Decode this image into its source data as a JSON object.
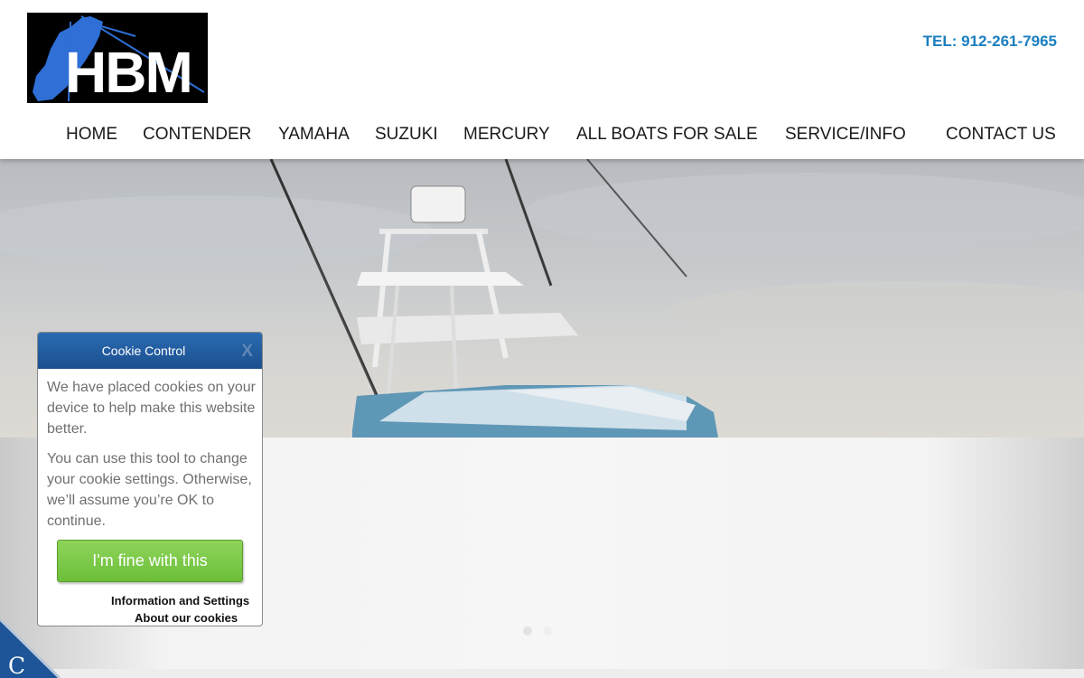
{
  "brand": {
    "logo_text": "HBM",
    "colors": {
      "logo_bg": "#000000",
      "logo_blue": "#2f6fd6",
      "logo_white": "#ffffff"
    }
  },
  "header": {
    "tel": "TEL: 912-261-7965"
  },
  "nav": {
    "items": [
      {
        "label": "HOME"
      },
      {
        "label": "CONTENDER"
      },
      {
        "label": "YAMAHA"
      },
      {
        "label": "SUZUKI"
      },
      {
        "label": "MERCURY"
      },
      {
        "label": "ALL BOATS FOR SALE"
      },
      {
        "label": "SERVICE/INFO"
      },
      {
        "label": "CONTACT US"
      }
    ]
  },
  "hero": {
    "image_subject": "boat-photo"
  },
  "slider": {
    "active_index": 0,
    "dot_count": 2
  },
  "cookie": {
    "title": "Cookie Control",
    "close_label": "X",
    "paragraph1": "We have placed cookies on your device to help make this website better.",
    "paragraph2": "You can use this tool to change your cookie settings. Otherwise, we’ll assume you’re OK to continue.",
    "accept_label": "I'm fine with this",
    "info_link": "Information and Settings",
    "about_link": "About our cookies"
  },
  "corner_badge": {
    "letter": "C",
    "color": "#1d5598"
  }
}
